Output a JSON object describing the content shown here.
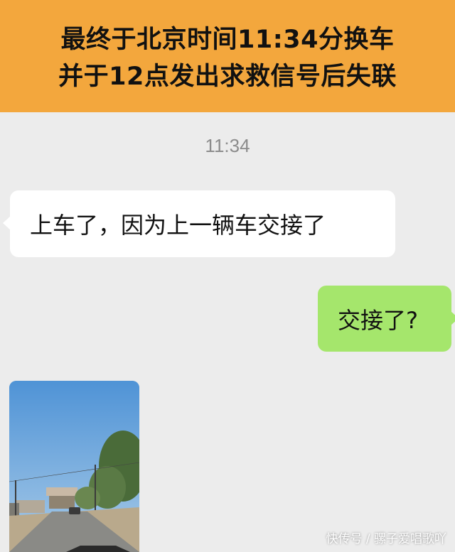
{
  "banner": {
    "line1": "最终于北京时间11:34分换车",
    "line2": "并于12点发出求救信号后失联",
    "background": "#f3a73d"
  },
  "chat": {
    "timestamp": "11:34",
    "messages": [
      {
        "side": "left",
        "text": "上车了，因为上一辆车交接了"
      },
      {
        "side": "right",
        "text": "交接了?"
      }
    ],
    "bubble_colors": {
      "incoming": "#ffffff",
      "outgoing": "#a5e66c"
    }
  },
  "watermark": "快传号 / 骡子爱唱歌吖"
}
